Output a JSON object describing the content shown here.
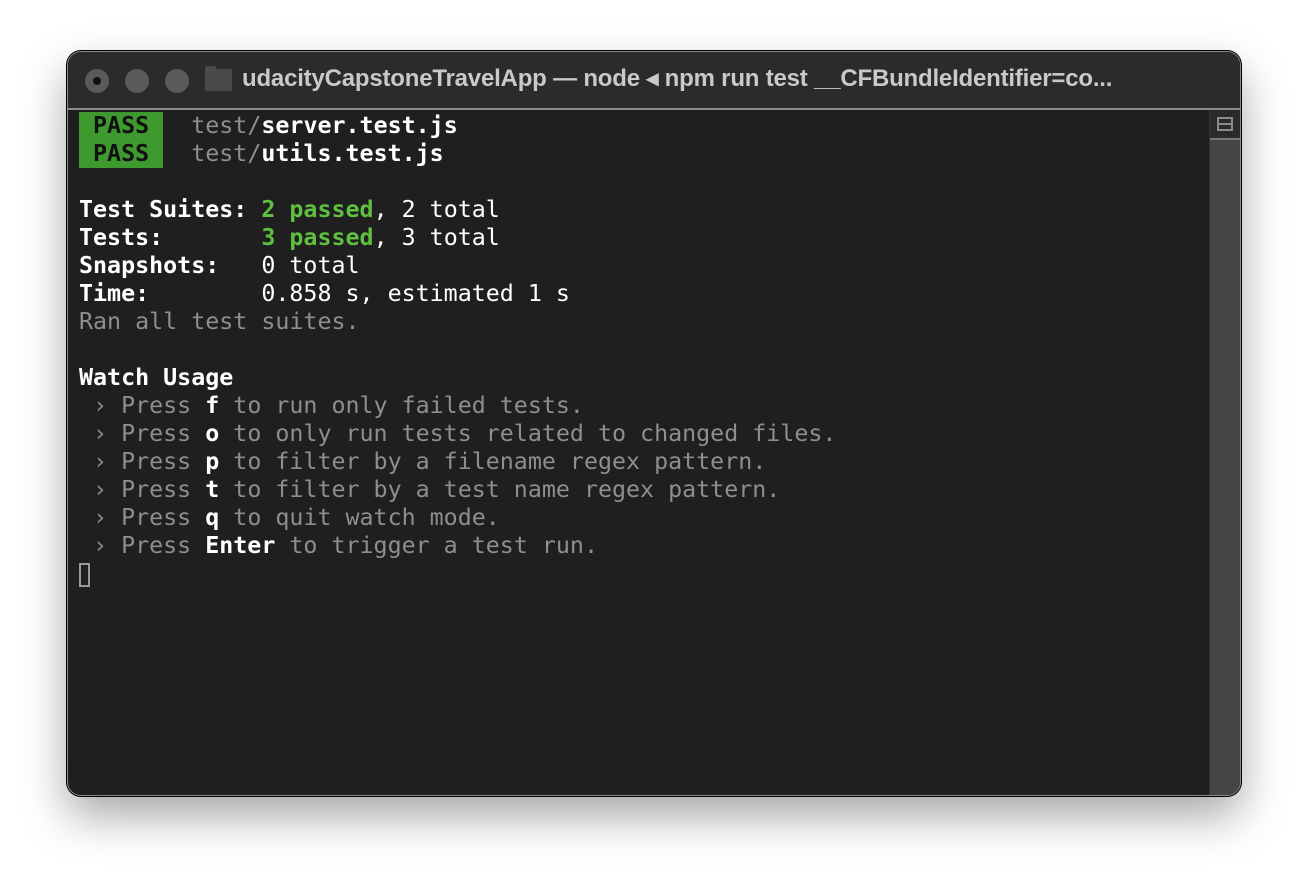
{
  "window": {
    "title": "udacityCapstoneTravelApp — node ◂ npm run test __CFBundleIdentifier=co..."
  },
  "terminal": {
    "results": [
      {
        "badge": "PASS",
        "dir": "test/",
        "file": "server.test.js"
      },
      {
        "badge": "PASS",
        "dir": "test/",
        "file": "utils.test.js"
      }
    ],
    "summary": {
      "suites_label": "Test Suites: ",
      "suites_passed": "2 passed",
      "suites_total": ", 2 total",
      "tests_label": "Tests:       ",
      "tests_passed": "3 passed",
      "tests_total": ", 3 total",
      "snapshots_label": "Snapshots:   ",
      "snapshots_value": "0 total",
      "time_label": "Time:        ",
      "time_value": "0.858 s, estimated 1 s",
      "ran": "Ran all test suites."
    },
    "watch": {
      "heading": "Watch Usage",
      "items": [
        {
          "prefix": " › Press ",
          "key": "f",
          "text": " to run only failed tests."
        },
        {
          "prefix": " › Press ",
          "key": "o",
          "text": " to only run tests related to changed files."
        },
        {
          "prefix": " › Press ",
          "key": "p",
          "text": " to filter by a filename regex pattern."
        },
        {
          "prefix": " › Press ",
          "key": "t",
          "text": " to filter by a test name regex pattern."
        },
        {
          "prefix": " › Press ",
          "key": "q",
          "text": " to quit watch mode."
        },
        {
          "prefix": " › Press ",
          "key": "Enter",
          "text": " to trigger a test run."
        }
      ]
    }
  },
  "colors": {
    "pass_badge": "#3e9a2e",
    "passed_text": "#5fbf3f",
    "background": "#1f1f1f"
  }
}
